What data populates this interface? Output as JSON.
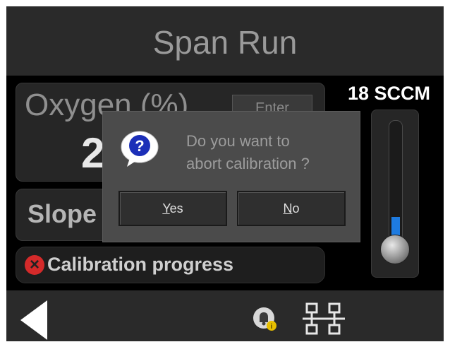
{
  "header": {
    "title": "Span Run"
  },
  "oxygen": {
    "label": "Oxygen (%)",
    "enter_label": "Enter",
    "value": "2"
  },
  "slope": {
    "label": "Slope"
  },
  "progress": {
    "label": "Calibration progress",
    "status_icon": "error-x-icon"
  },
  "flow": {
    "readout": "18 SCCM",
    "level_fraction": 0.2
  },
  "dialog": {
    "icon": "question-bubble-icon",
    "message_line1": "Do you want to",
    "message_line2": "abort calibration ?",
    "yes": {
      "first": "Y",
      "rest": "es"
    },
    "no": {
      "first": "N",
      "rest": "o"
    }
  },
  "footer": {
    "icons": [
      "back-arrow-icon",
      "alarm-bell-icon",
      "network-icon"
    ]
  },
  "colors": {
    "accent_blue": "#1e7be0",
    "error_red": "#d42a2a",
    "background": "#000000"
  }
}
